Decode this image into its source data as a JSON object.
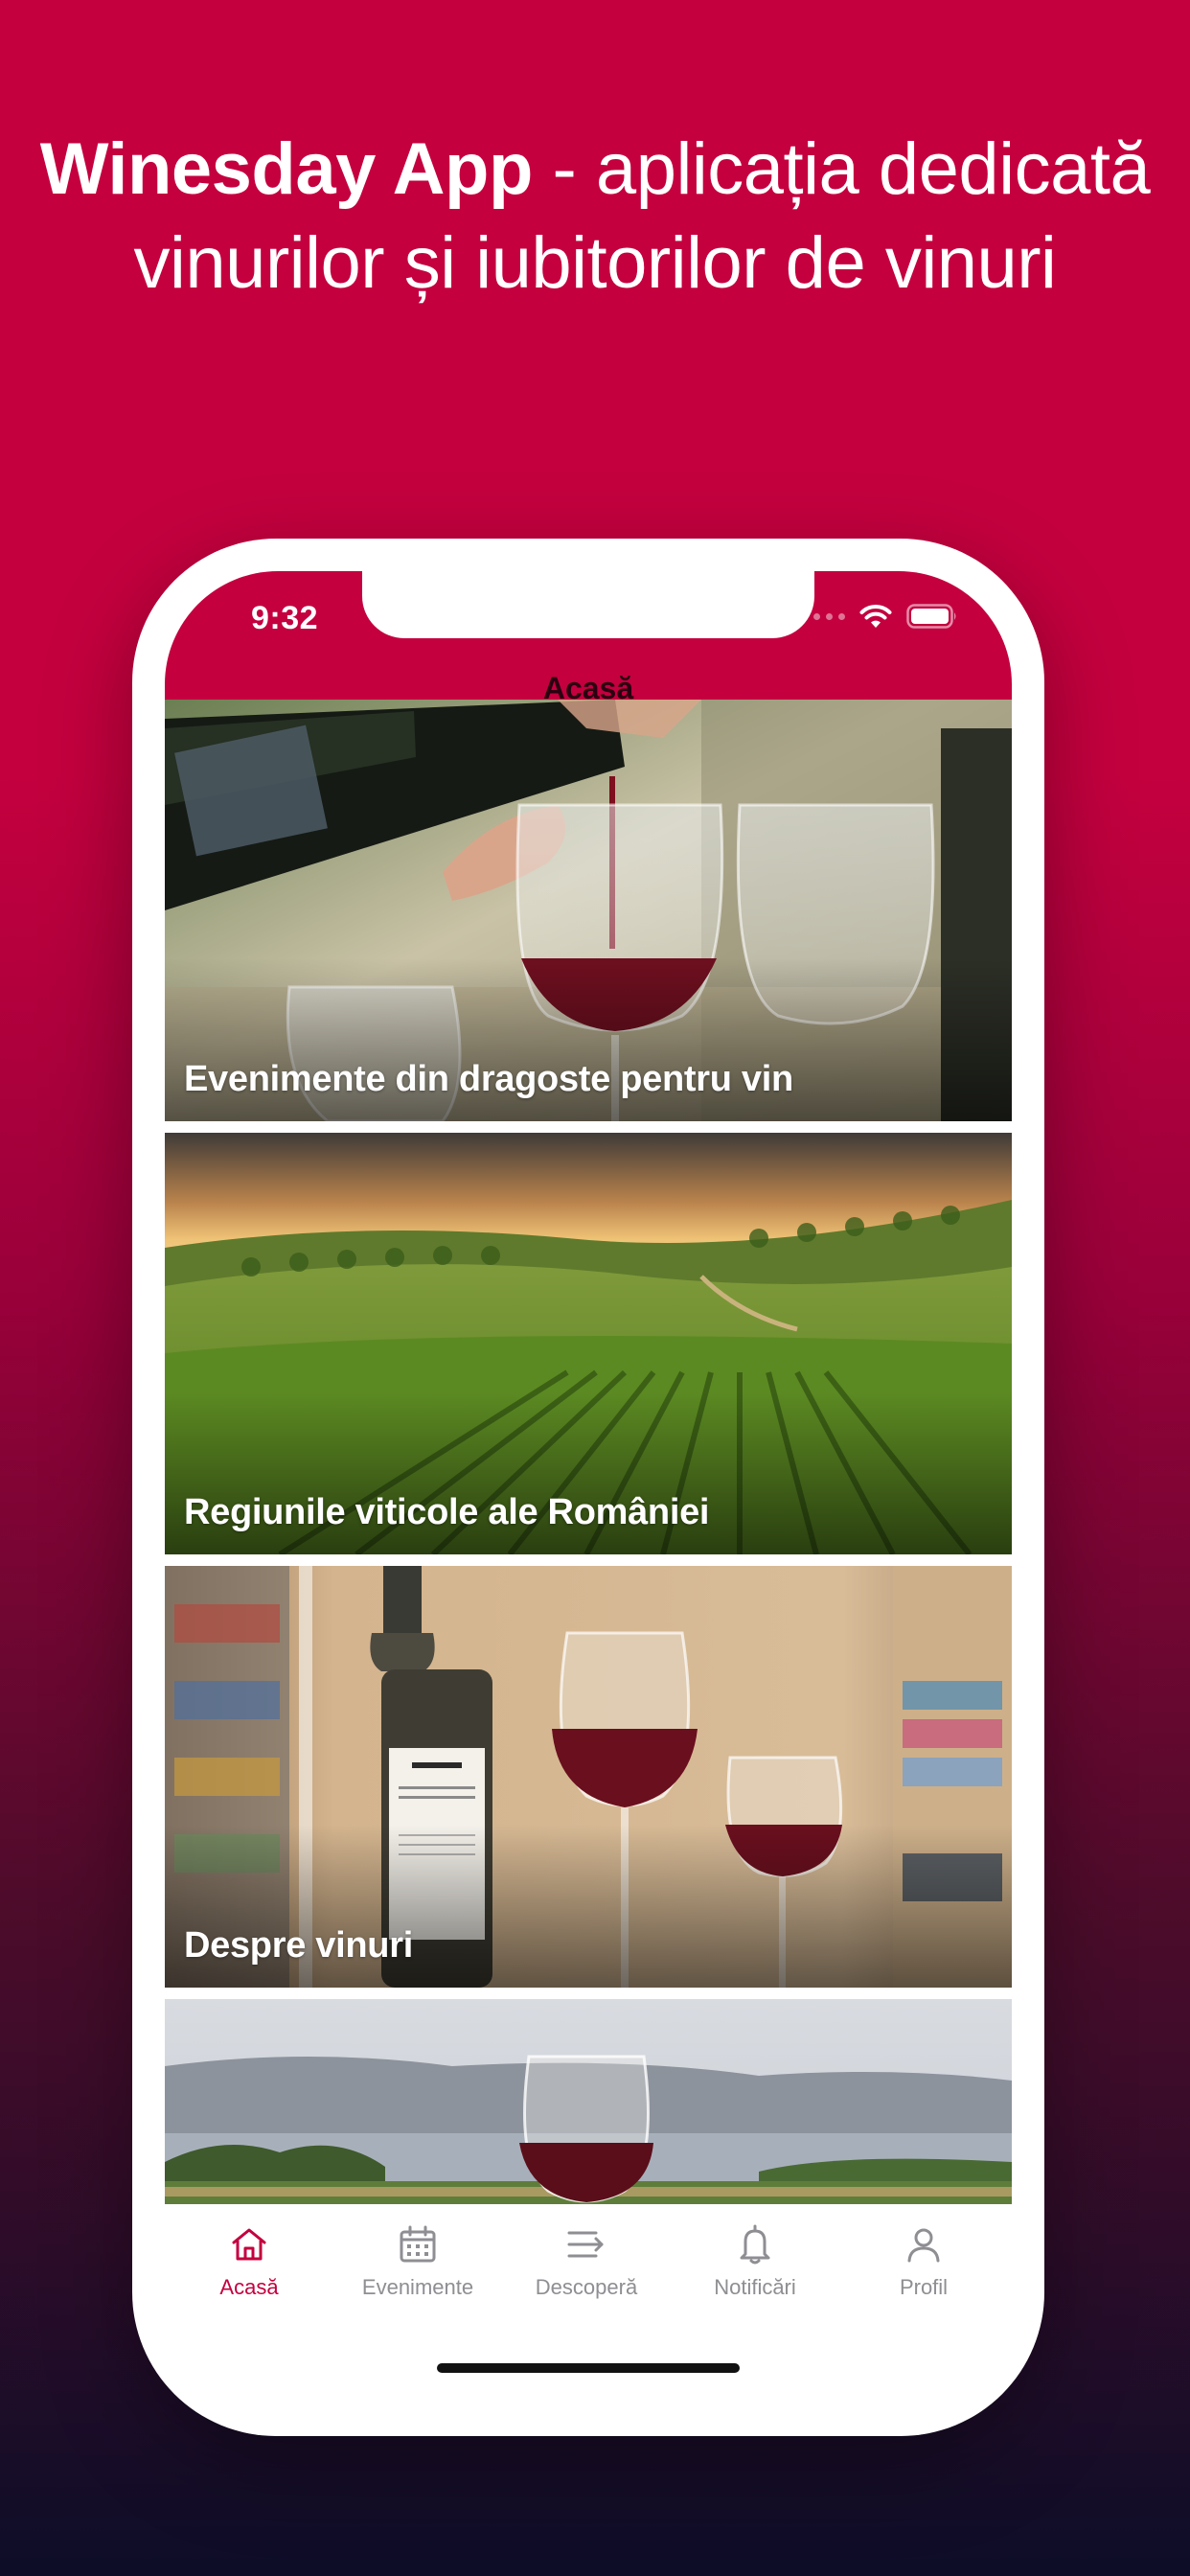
{
  "headline": {
    "brand": "Winesday App",
    "tagline": " - aplicația dedicată vinurilor și iubitorilor de vinuri"
  },
  "status_bar": {
    "time": "9:32",
    "icons": [
      "signal-icon",
      "wifi-icon",
      "battery-icon"
    ]
  },
  "nav": {
    "title": "Acasă"
  },
  "feed": {
    "cards": [
      {
        "title": "Evenimente din dragoste pentru vin",
        "image": "wine-pouring-photo"
      },
      {
        "title": "Regiunile viticole ale României",
        "image": "vineyard-landscape-photo"
      },
      {
        "title": "Despre vinuri",
        "image": "wine-bottle-glasses-photo"
      },
      {
        "title": "",
        "image": "wine-glass-lake-photo"
      }
    ]
  },
  "tabbar": {
    "items": [
      {
        "label": "Acasă",
        "icon": "home-icon",
        "active": true
      },
      {
        "label": "Evenimente",
        "icon": "calendar-icon",
        "active": false
      },
      {
        "label": "Descoperă",
        "icon": "list-arrow-icon",
        "active": false
      },
      {
        "label": "Notificări",
        "icon": "bell-icon",
        "active": false
      },
      {
        "label": "Profil",
        "icon": "person-icon",
        "active": false
      }
    ]
  },
  "colors": {
    "brand": "#c4003f",
    "tab_inactive": "#8e8e93",
    "background_bottom": "#0d0d28"
  }
}
